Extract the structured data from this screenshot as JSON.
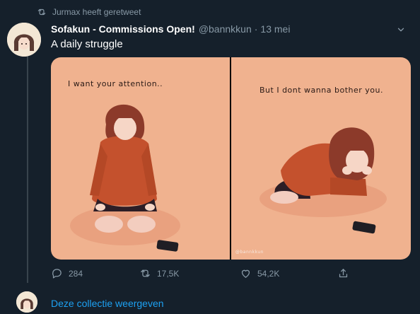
{
  "retweet": {
    "label": "Jurmax heeft geretweet"
  },
  "tweet": {
    "display_name": "Sofakun - Commissions Open!",
    "handle": "@bannkkun",
    "separator": "·",
    "time": "13 mei",
    "text": "A daily struggle",
    "media": {
      "left_caption": "I want your attention..",
      "right_caption": "But I dont wanna bother you.",
      "watermark": "@bannkkun"
    },
    "actions": {
      "replies": "284",
      "retweets": "17,5K",
      "likes": "54,2K"
    }
  },
  "thread": {
    "show_collection": "Deze collectie weergeven"
  },
  "colors": {
    "background": "#15202b",
    "secondary_text": "#8899a6",
    "accent": "#1da1f2",
    "artwork_bg": "#f0b28f"
  },
  "icons": [
    "retweet-icon",
    "chevron-down-icon",
    "reply-icon",
    "retweet-action-icon",
    "like-icon",
    "share-icon"
  ]
}
